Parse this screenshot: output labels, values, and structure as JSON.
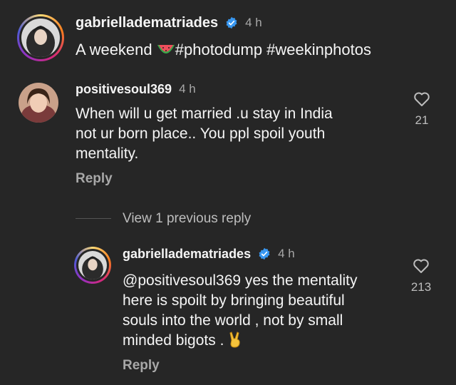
{
  "caption": {
    "username": "gabrielladematriades",
    "time": "4 h",
    "text_prefix": "A weekend ",
    "text_hashtags": "#photodump #weekinphotos",
    "emoji": "watermelon"
  },
  "comment": {
    "username": "positivesoul369",
    "time": "4 h",
    "lines": [
      "When will u get married .u stay in India",
      "not ur born place.. You ppl spoil youth",
      "mentality."
    ],
    "reply_label": "Reply",
    "like_count": "21"
  },
  "view_replies": "View 1 previous reply",
  "reply": {
    "username": "gabrielladematriades",
    "time": "4 h",
    "lines": [
      "@positivesoul369 yes the mentality",
      "here is spoilt by bringing beautiful",
      "souls into the world , not by small",
      "minded bigots . "
    ],
    "emoji": "victory-hand",
    "reply_label": "Reply",
    "like_count": "213"
  },
  "colors": {
    "background": "#262626",
    "text": "#f5f5f5",
    "muted": "#a8a8a8",
    "verified": "#3897f0"
  }
}
